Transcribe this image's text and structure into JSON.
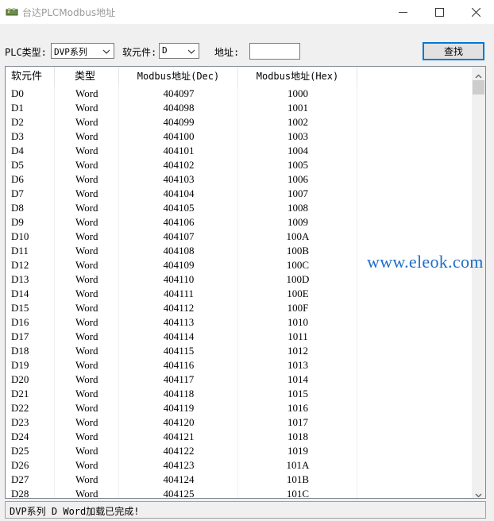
{
  "window": {
    "title": "台达PLCModbus地址",
    "icon": "plc-app-icon",
    "controls": [
      "minimize-icon",
      "maximize-icon",
      "close-icon"
    ]
  },
  "toolbar": {
    "plc_type_label": "PLC类型:",
    "plc_type_value": "DVP系列",
    "element_label": "软元件:",
    "element_value": "D",
    "address_label": "地址:",
    "address_value": "",
    "find_label": "查找"
  },
  "table": {
    "columns": [
      "软元件",
      "类型",
      "Modbus地址(Dec)",
      "Modbus地址(Hex)"
    ],
    "rows": [
      [
        "D0",
        "Word",
        "404097",
        "1000"
      ],
      [
        "D1",
        "Word",
        "404098",
        "1001"
      ],
      [
        "D2",
        "Word",
        "404099",
        "1002"
      ],
      [
        "D3",
        "Word",
        "404100",
        "1003"
      ],
      [
        "D4",
        "Word",
        "404101",
        "1004"
      ],
      [
        "D5",
        "Word",
        "404102",
        "1005"
      ],
      [
        "D6",
        "Word",
        "404103",
        "1006"
      ],
      [
        "D7",
        "Word",
        "404104",
        "1007"
      ],
      [
        "D8",
        "Word",
        "404105",
        "1008"
      ],
      [
        "D9",
        "Word",
        "404106",
        "1009"
      ],
      [
        "D10",
        "Word",
        "404107",
        "100A"
      ],
      [
        "D11",
        "Word",
        "404108",
        "100B"
      ],
      [
        "D12",
        "Word",
        "404109",
        "100C"
      ],
      [
        "D13",
        "Word",
        "404110",
        "100D"
      ],
      [
        "D14",
        "Word",
        "404111",
        "100E"
      ],
      [
        "D15",
        "Word",
        "404112",
        "100F"
      ],
      [
        "D16",
        "Word",
        "404113",
        "1010"
      ],
      [
        "D17",
        "Word",
        "404114",
        "1011"
      ],
      [
        "D18",
        "Word",
        "404115",
        "1012"
      ],
      [
        "D19",
        "Word",
        "404116",
        "1013"
      ],
      [
        "D20",
        "Word",
        "404117",
        "1014"
      ],
      [
        "D21",
        "Word",
        "404118",
        "1015"
      ],
      [
        "D22",
        "Word",
        "404119",
        "1016"
      ],
      [
        "D23",
        "Word",
        "404120",
        "1017"
      ],
      [
        "D24",
        "Word",
        "404121",
        "1018"
      ],
      [
        "D25",
        "Word",
        "404122",
        "1019"
      ],
      [
        "D26",
        "Word",
        "404123",
        "101A"
      ],
      [
        "D27",
        "Word",
        "404124",
        "101B"
      ],
      [
        "D28",
        "Word",
        "404125",
        "101C"
      ]
    ]
  },
  "status": {
    "text": "DVP系列 D Word加载已完成!"
  },
  "watermark": "www.eleok.com"
}
